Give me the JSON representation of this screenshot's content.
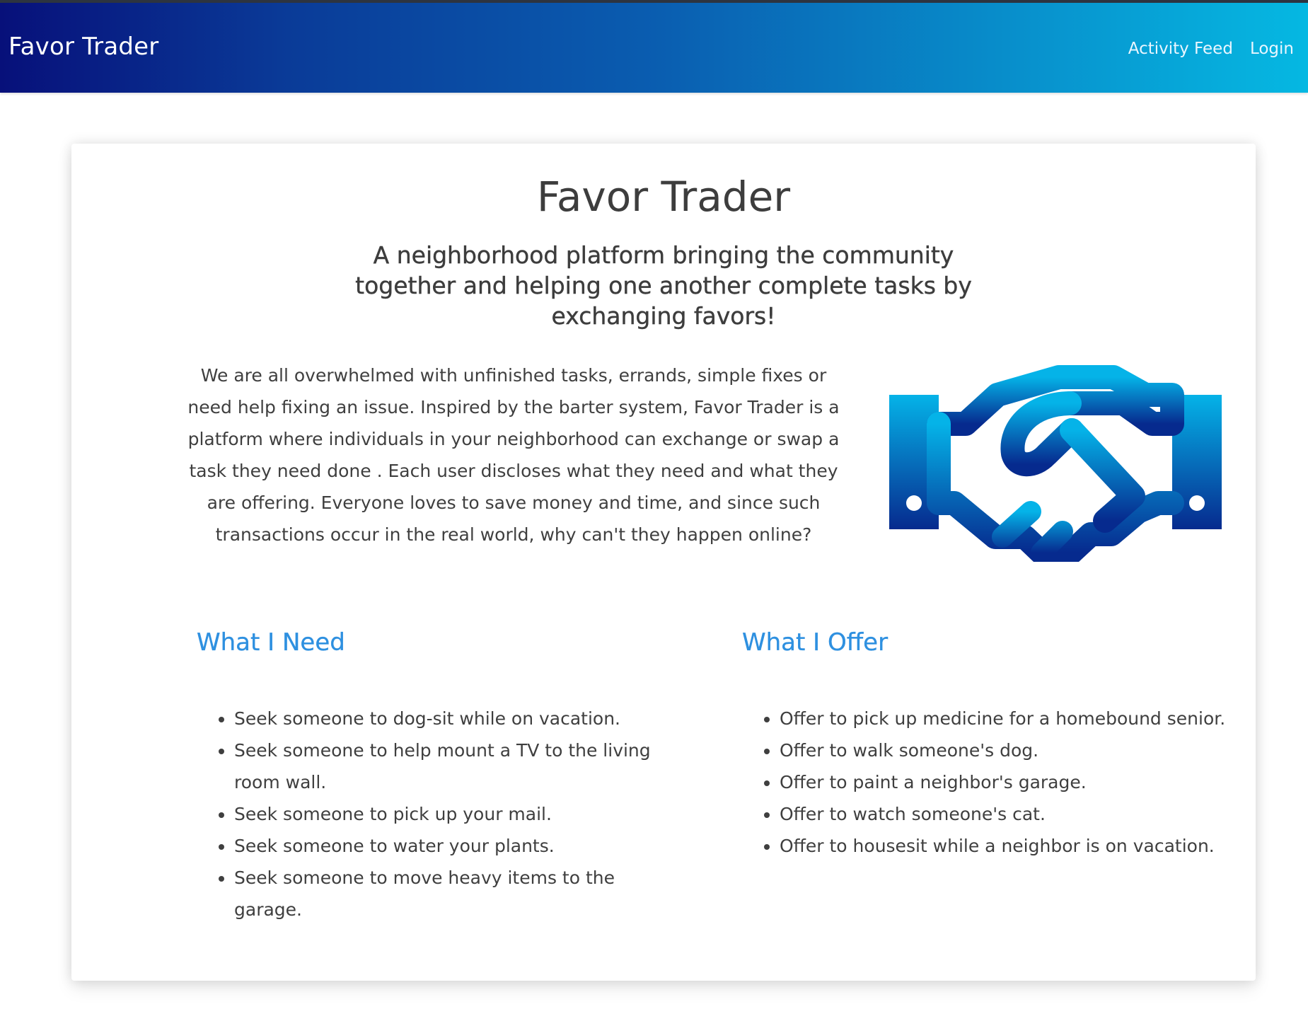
{
  "header": {
    "brand": "Favor Trader",
    "nav": {
      "activity_feed": "Activity Feed",
      "login": "Login"
    }
  },
  "main": {
    "title": "Favor Trader",
    "subtitle": "A neighborhood platform bringing the community together and helping one another complete tasks by exchanging favors!",
    "intro": "We are all overwhelmed with unfinished tasks, errands, simple fixes or need help fixing an issue. Inspired by the barter system, Favor Trader is a platform where individuals in your neighborhood can exchange or swap a task they need done . Each user discloses what they need and what they are offering. Everyone loves to save money and time, and since such transactions occur in the real world, why can't they happen online?",
    "illustration": "handshake-icon",
    "need": {
      "title": "What I Need",
      "items": [
        "Seek someone to dog-sit while on vacation.",
        "Seek someone to help mount a TV to the living room wall.",
        "Seek someone to pick up your mail.",
        "Seek someone to water your plants.",
        "Seek someone to move heavy items to the garage."
      ]
    },
    "offer": {
      "title": "What I Offer",
      "items": [
        "Offer to pick up medicine for a homebound senior.",
        "Offer to walk someone's dog.",
        "Offer to paint a neighbor's garage.",
        "Offer to watch someone's cat.",
        "Offer to housesit while a neighbor is on vacation."
      ]
    }
  },
  "colors": {
    "header_gradient_start": "#07107a",
    "header_gradient_end": "#05b8e2",
    "accent_heading": "#2e90e0",
    "icon_gradient_top": "#05b3e8",
    "icon_gradient_bottom": "#062a8e",
    "text": "#3d3d3d"
  }
}
